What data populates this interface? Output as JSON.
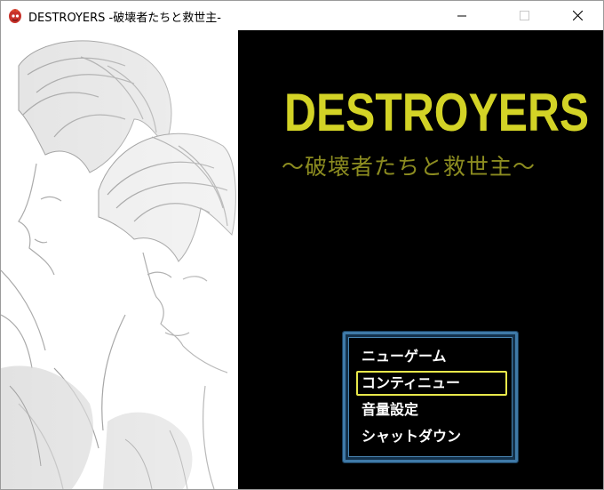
{
  "window": {
    "title": "DESTROYERS -破壊者たちと救世主-",
    "icon": "game-app-icon"
  },
  "controls": {
    "minimize": "minimize-icon",
    "maximize": "maximize-icon",
    "close": "close-icon"
  },
  "title_screen": {
    "logo": "DESTROYERS",
    "subtitle": "～破壊者たちと救世主～",
    "logo_color": "#d3d326",
    "subtitle_color": "#8c8c20"
  },
  "menu": {
    "selected_index": 1,
    "items": [
      {
        "label": "ニューゲーム"
      },
      {
        "label": "コンティニュー"
      },
      {
        "label": "音量設定"
      },
      {
        "label": "シャットダウン"
      }
    ],
    "border_color": "#3f7aa8",
    "highlight_color": "#e8e84a"
  }
}
